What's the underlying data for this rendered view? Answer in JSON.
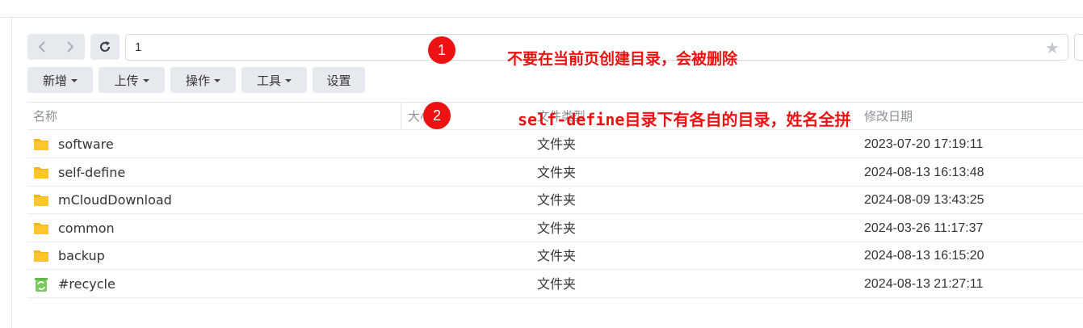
{
  "nav": {
    "back_icon": "chevron-left-icon",
    "forward_icon": "chevron-right-icon",
    "refresh_icon": "refresh-icon"
  },
  "path": {
    "value": "1",
    "star_icon": "star-icon"
  },
  "toolbar": {
    "new_label": "新增",
    "upload_label": "上传",
    "action_label": "操作",
    "tools_label": "工具",
    "settings_label": "设置"
  },
  "table": {
    "headers": {
      "name": "名称",
      "size": "大小",
      "type": "文件类型",
      "modified": "修改日期"
    },
    "rows": [
      {
        "name": "software",
        "type": "文件夹",
        "modified": "2023-07-20 17:19:11",
        "icon": "folder-icon"
      },
      {
        "name": "self-define",
        "type": "文件夹",
        "modified": "2024-08-13 16:13:48",
        "icon": "folder-icon"
      },
      {
        "name": "mCloudDownload",
        "type": "文件夹",
        "modified": "2024-08-09 13:43:25",
        "icon": "folder-icon"
      },
      {
        "name": "common",
        "type": "文件夹",
        "modified": "2024-03-26 11:17:37",
        "icon": "folder-icon"
      },
      {
        "name": "backup",
        "type": "文件夹",
        "modified": "2024-08-13 16:15:20",
        "icon": "folder-icon"
      },
      {
        "name": "#recycle",
        "type": "文件夹",
        "modified": "2024-08-13 21:27:11",
        "icon": "recycle-bin-icon"
      }
    ]
  },
  "annotations": [
    {
      "badge": "1",
      "text": "不要在当前页创建目录，会被删除"
    },
    {
      "badge": "2",
      "text": "self-define目录下有各自的目录，姓名全拼"
    }
  ],
  "colors": {
    "accent_red": "#ee1111",
    "folder": "#f6b40f",
    "recycle": "#62b84a",
    "button_bg": "#e6eaef"
  }
}
